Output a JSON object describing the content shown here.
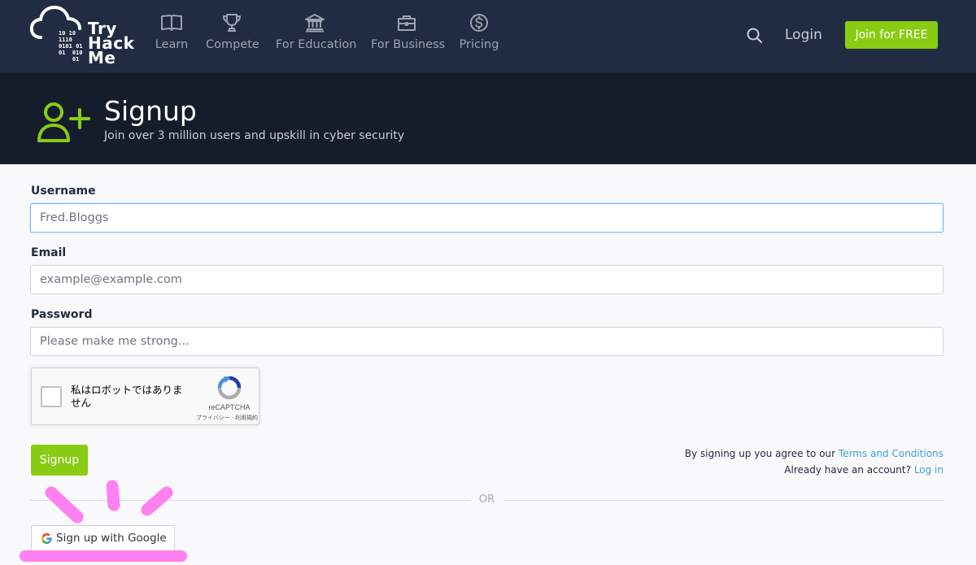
{
  "nav": {
    "logo_word": "Try\nHack\nMe",
    "logo_bits": "10 10\n1110\n0101 01\n01  010\n    01",
    "items": [
      {
        "label": "Learn",
        "icon": "book-icon"
      },
      {
        "label": "Compete",
        "icon": "trophy-icon"
      },
      {
        "label": "For Education",
        "icon": "institution-icon"
      },
      {
        "label": "For Business",
        "icon": "briefcase-icon"
      },
      {
        "label": "Pricing",
        "icon": "dollar-coin-icon"
      }
    ],
    "login_label": "Login",
    "join_label": "Join for FREE"
  },
  "banner": {
    "title": "Signup",
    "subtitle": "Join over 3 million users and upskill in cyber security",
    "icon": "user-plus-icon"
  },
  "form": {
    "username": {
      "label": "Username",
      "value": "",
      "placeholder": "Fred.Bloggs"
    },
    "email": {
      "label": "Email",
      "value": "",
      "placeholder": "example@example.com"
    },
    "password": {
      "label": "Password",
      "value": "",
      "placeholder": "Please make me strong..."
    },
    "recaptcha": {
      "checkbox_label": "私はロボットではありません",
      "brand": "reCAPTCHA",
      "links": "プライバシー - 利用規約"
    },
    "signup_label": "Signup",
    "terms_prefix": "By signing up you agree to our",
    "terms_link": "Terms and Conditions",
    "account_prefix": "Already have an account?",
    "login_link": "Log in",
    "or_label": "OR",
    "google_label": "Sign up with Google"
  },
  "colors": {
    "nav_bg": "#212c42",
    "banner_bg": "#151c2b",
    "accent_green": "#88cc14",
    "link_blue": "#3c9dd8",
    "annotation_pink": "#ff80f0"
  }
}
